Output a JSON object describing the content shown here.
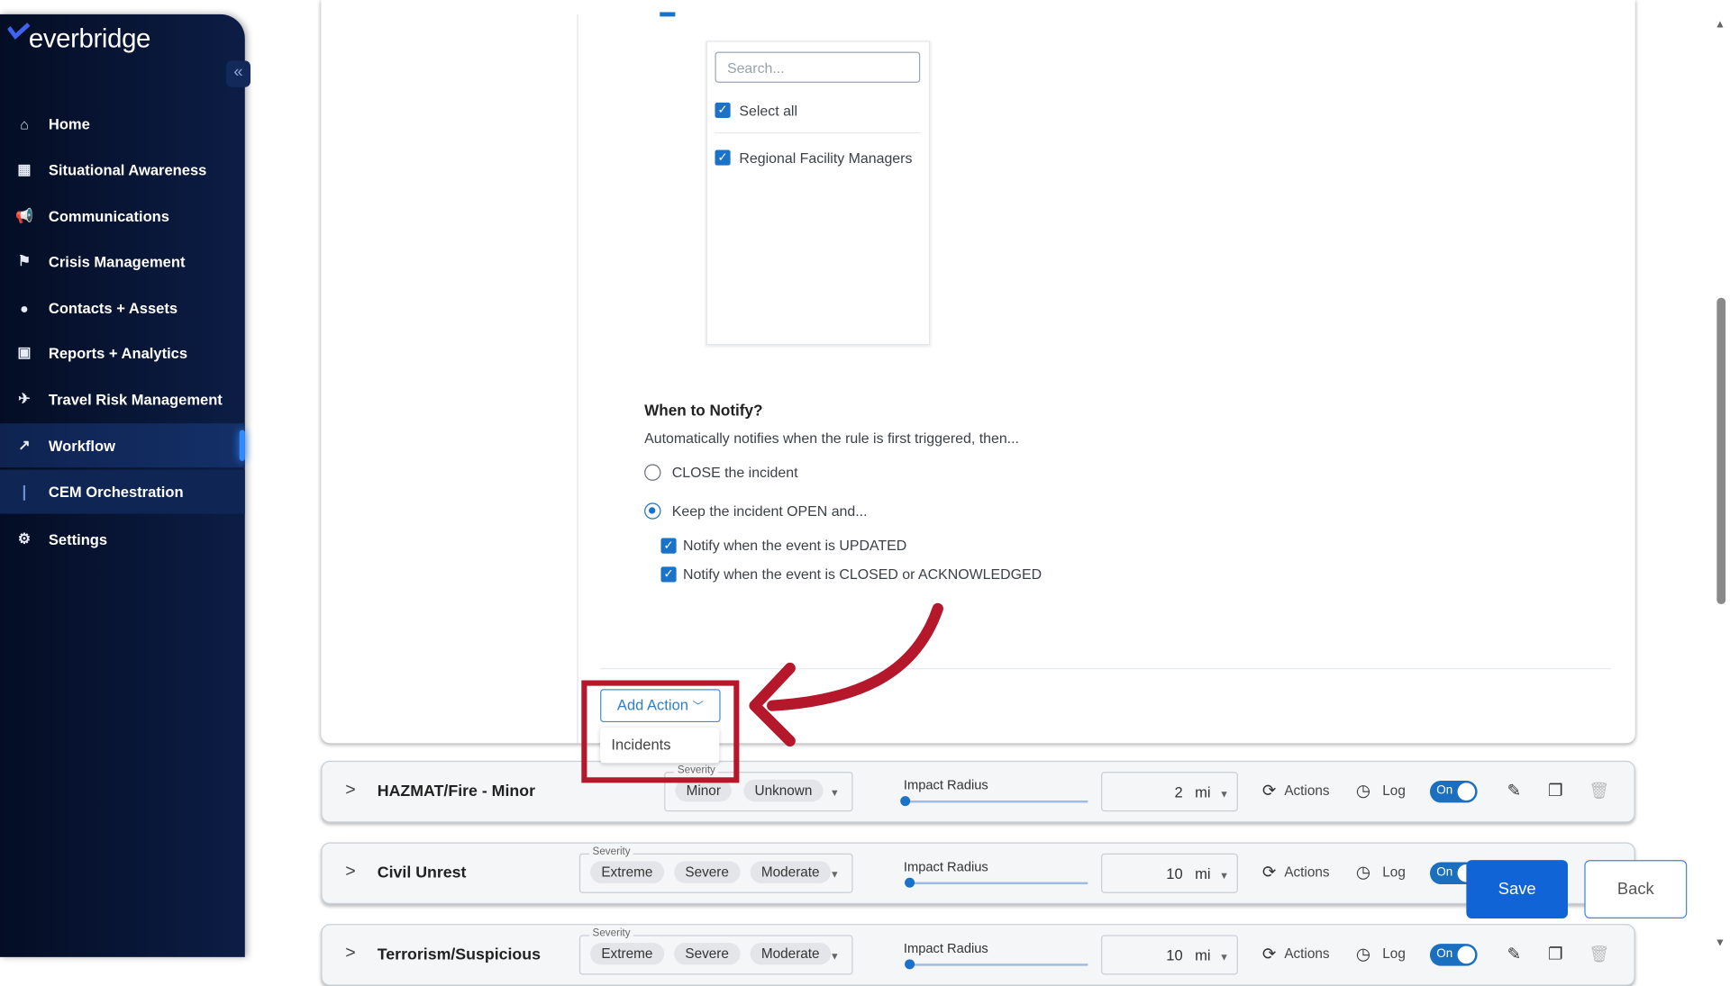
{
  "brand": "everbridge",
  "sidebar": {
    "collapse_icon": "double-chevron-left",
    "items": [
      {
        "label": "Home",
        "icon": "home-icon",
        "glyph": "⌂"
      },
      {
        "label": "Situational Awareness",
        "icon": "map-icon",
        "glyph": "▦"
      },
      {
        "label": "Communications",
        "icon": "megaphone-icon",
        "glyph": "📢"
      },
      {
        "label": "Crisis Management",
        "icon": "crisis-icon",
        "glyph": "⚑"
      },
      {
        "label": "Contacts + Assets",
        "icon": "pin-icon",
        "glyph": "●"
      },
      {
        "label": "Reports + Analytics",
        "icon": "report-icon",
        "glyph": "▣"
      },
      {
        "label": "Travel Risk Management",
        "icon": "plane-icon",
        "glyph": "✈"
      },
      {
        "label": "Workflow",
        "icon": "chart-line-icon",
        "glyph": "↗"
      },
      {
        "label": "CEM Orchestration",
        "icon": "sub-item-bar",
        "glyph": "|"
      },
      {
        "label": "Settings",
        "icon": "gear-icon",
        "glyph": "⚙"
      }
    ],
    "active": "Workflow",
    "active_sub": "CEM Orchestration"
  },
  "recipients": {
    "search_placeholder": "Search...",
    "select_all": "Select all",
    "items": [
      "Regional Facility Managers"
    ]
  },
  "notify": {
    "title": "When to Notify?",
    "subtitle": "Automatically notifies when the rule is first triggered, then...",
    "options": [
      {
        "label": "CLOSE the incident",
        "selected": false
      },
      {
        "label": "Keep the incident OPEN and...",
        "selected": true
      }
    ],
    "checks": [
      {
        "label": "Notify when the event is UPDATED",
        "checked": true
      },
      {
        "label": "Notify when the event is CLOSED or ACKNOWLEDGED",
        "checked": true
      }
    ]
  },
  "add_action": {
    "label": "Add Action",
    "menu": [
      "Incidents"
    ]
  },
  "annotation_color": "#b5172b",
  "rows": [
    {
      "title": "HAZMAT/Fire - Minor",
      "severity_label": "Severity",
      "chips": [
        "Minor",
        "Unknown"
      ],
      "radius_label": "Impact Radius",
      "radius": "2",
      "unit": "mi",
      "actions": "Actions",
      "log": "Log",
      "toggle": "On"
    },
    {
      "title": "Civil Unrest",
      "severity_label": "Severity",
      "chips": [
        "Extreme",
        "Severe",
        "Moderate"
      ],
      "radius_label": "Impact Radius",
      "radius": "10",
      "unit": "mi",
      "actions": "Actions",
      "log": "Log",
      "toggle": "On"
    },
    {
      "title": "Terrorism/Suspicious",
      "severity_label": "Severity",
      "chips": [
        "Extreme",
        "Severe",
        "Moderate"
      ],
      "radius_label": "Impact Radius",
      "radius": "10",
      "unit": "mi",
      "actions": "Actions",
      "log": "Log",
      "toggle": "On"
    }
  ],
  "footer": {
    "save": "Save",
    "back": "Back"
  },
  "colors": {
    "primary": "#1164d6",
    "sidebar": "#0c1d45"
  }
}
